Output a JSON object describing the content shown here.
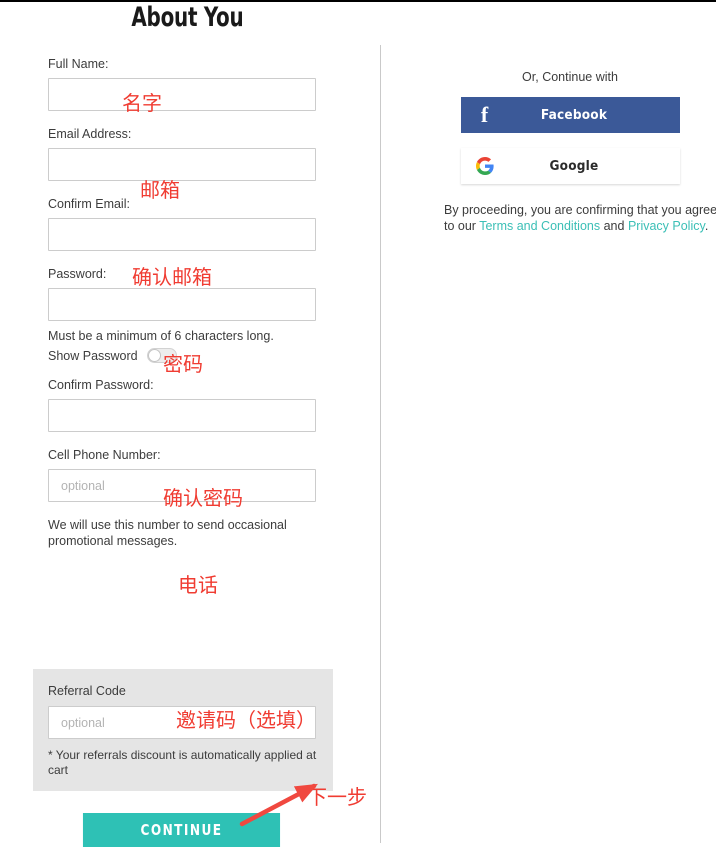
{
  "page": {
    "title": "About You"
  },
  "form": {
    "fields": [
      {
        "label": "Full Name:",
        "value": "",
        "placeholder": ""
      },
      {
        "label": "Email Address:",
        "value": "",
        "placeholder": ""
      },
      {
        "label": "Confirm Email:",
        "value": "",
        "placeholder": ""
      },
      {
        "label": "Password:",
        "value": "",
        "placeholder": ""
      },
      {
        "label": "Confirm Password:",
        "value": "",
        "placeholder": ""
      },
      {
        "label": "Cell Phone Number:",
        "value": "",
        "placeholder": "optional"
      }
    ],
    "password_helper": "Must be a minimum of 6 characters long.",
    "show_password_label": "Show Password",
    "show_password_state": "off",
    "phone_helper": "We will use this number to send occasional promotional messages.",
    "continue_label": "CONTINUE"
  },
  "referral": {
    "label": "Referral Code",
    "placeholder": "optional",
    "value": "",
    "note": "* Your referrals discount is automatically applied at cart",
    "background_color": "#e5e5e5"
  },
  "social": {
    "heading": "Or, Continue with",
    "facebook": {
      "label": "Facebook",
      "icon": "facebook-f-icon",
      "color": "#3b5998"
    },
    "google": {
      "label": "Google",
      "icon": "google-g-icon",
      "color": "#ffffff"
    },
    "terms": {
      "prefix": "By proceeding, you are confirming that you agree",
      "middle": "to our ",
      "link1": "Terms and Conditions",
      "conjunction": " and ",
      "link2": "Privacy Policy",
      "suffix": ".",
      "link_color": "#3bbfb6"
    }
  },
  "annotations": {
    "color": "#f03c32",
    "full_name": "名字",
    "email": "邮箱",
    "confirm_email": "确认邮箱",
    "password": "密码",
    "confirm_password": "确认密码",
    "phone": "电话",
    "referral": "邀请码（选填）",
    "next_step": "下一步"
  },
  "theme": {
    "accent_color": "#2ec1b5",
    "input_border": "#cccccc",
    "divider_color": "#c9c9c9"
  }
}
